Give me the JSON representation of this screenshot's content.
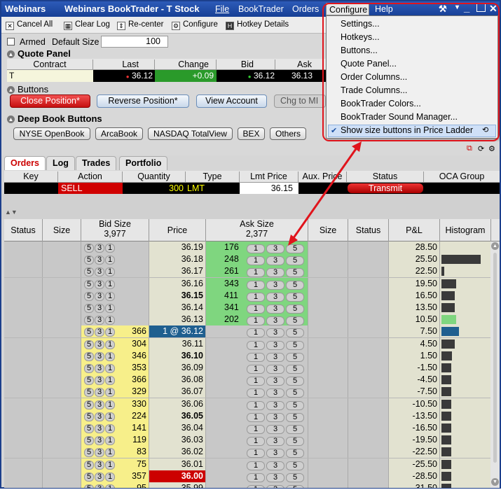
{
  "window": {
    "app_name": "Webinars",
    "title": "Webinars BookTrader - T Stock",
    "menus": [
      "File",
      "BookTrader",
      "Orders",
      "Configure",
      "Help"
    ]
  },
  "toolbar": {
    "cancel_all": "Cancel All",
    "clear_log": "Clear Log",
    "recenter": "Re-center",
    "configure": "Configure",
    "hotkey_details": "Hotkey Details"
  },
  "settings": {
    "armed_label": "Armed",
    "default_size_label": "Default Size",
    "default_size_value": "100"
  },
  "quote_panel": {
    "title": "Quote Panel",
    "headers": [
      "Contract",
      "Last",
      "Change",
      "Bid",
      "Ask"
    ],
    "contract": "T",
    "last": "36.12",
    "change": "+0.09",
    "bid": "36.12",
    "ask": "36.13"
  },
  "buttons_panel": {
    "title": "Buttons",
    "close_position": "Close Position*",
    "reverse_position": "Reverse Position*",
    "view_account": "View Account",
    "chg_to_mid": "Chg to MI"
  },
  "deep_book": {
    "title": "Deep Book Buttons",
    "buttons": [
      "NYSE OpenBook",
      "ArcaBook",
      "NASDAQ TotalView",
      "BEX",
      "Others"
    ]
  },
  "configure_menu": {
    "items": [
      "Settings...",
      "Hotkeys...",
      "Buttons...",
      "Quote Panel...",
      "Order Columns...",
      "Trade Columns...",
      "BookTrader Colors...",
      "BookTrader Sound Manager...",
      "Show size buttons in Price Ladder"
    ],
    "checked_item": "Show size buttons in Price Ladder"
  },
  "tabs": [
    "Orders",
    "Log",
    "Trades",
    "Portfolio"
  ],
  "orders": {
    "headers": [
      "Key",
      "Action",
      "Quantity",
      "Type",
      "Lmt Price",
      "Aux. Price",
      "Status",
      "OCA Group"
    ],
    "row": {
      "key": "",
      "action": "SELL",
      "quantity": "300",
      "type": "LMT",
      "lmt_price": "36.15",
      "aux_price": "",
      "status": "Transmit",
      "oca": ""
    }
  },
  "ladder": {
    "headers": {
      "status": "Status",
      "size": "Size",
      "bid_size": "Bid Size",
      "bid_total": "3,977",
      "price": "Price",
      "ask_size": "Ask Size",
      "ask_total": "2,377",
      "size2": "Size",
      "status2": "Status",
      "pl": "P&L",
      "histogram": "Histogram"
    },
    "size_buttons": [
      "5",
      "3",
      "1"
    ],
    "ask_buttons": [
      "1",
      "3",
      "5"
    ],
    "rows": [
      {
        "price": "36.19",
        "bid": "",
        "ask": "176",
        "pl": "28.50",
        "hist": 0.0
      },
      {
        "price": "36.18",
        "bid": "",
        "ask": "248",
        "pl": "25.50",
        "hist": 0.8
      },
      {
        "price": "36.17",
        "bid": "",
        "ask": "261",
        "pl": "22.50",
        "hist": 0.05
      },
      {
        "price": "36.16",
        "bid": "",
        "ask": "343",
        "pl": "19.50",
        "hist": 0.3
      },
      {
        "price": "36.15",
        "bid": "",
        "ask": "411",
        "pl": "16.50",
        "hist": 0.27
      },
      {
        "price": "36.14",
        "bid": "",
        "ask": "341",
        "pl": "13.50",
        "hist": 0.27
      },
      {
        "price": "36.13",
        "bid": "",
        "ask": "202",
        "pl": "10.50",
        "hist": 0.3
      },
      {
        "price": "1 @ 36.12",
        "bid": "366",
        "ask": "",
        "pl": "7.50",
        "hist": 0.35
      },
      {
        "price": "36.11",
        "bid": "304",
        "ask": "",
        "pl": "4.50",
        "hist": 0.27
      },
      {
        "price": "36.10",
        "bid": "346",
        "ask": "",
        "pl": "1.50",
        "hist": 0.22
      },
      {
        "price": "36.09",
        "bid": "353",
        "ask": "",
        "pl": "-1.50",
        "hist": 0.2
      },
      {
        "price": "36.08",
        "bid": "366",
        "ask": "",
        "pl": "-4.50",
        "hist": 0.2
      },
      {
        "price": "36.07",
        "bid": "329",
        "ask": "",
        "pl": "-7.50",
        "hist": 0.2
      },
      {
        "price": "36.06",
        "bid": "330",
        "ask": "",
        "pl": "-10.50",
        "hist": 0.2
      },
      {
        "price": "36.05",
        "bid": "224",
        "ask": "",
        "pl": "-13.50",
        "hist": 0.2
      },
      {
        "price": "36.04",
        "bid": "141",
        "ask": "",
        "pl": "-16.50",
        "hist": 0.2
      },
      {
        "price": "36.03",
        "bid": "119",
        "ask": "",
        "pl": "-19.50",
        "hist": 0.2
      },
      {
        "price": "36.02",
        "bid": "83",
        "ask": "",
        "pl": "-22.50",
        "hist": 0.2
      },
      {
        "price": "36.01",
        "bid": "75",
        "ask": "",
        "pl": "-25.50",
        "hist": 0.2
      },
      {
        "price": "36.00",
        "bid": "357",
        "ask": "",
        "pl": "-28.50",
        "hist": 0.2
      },
      {
        "price": "35.99",
        "bid": "95",
        "ask": "",
        "pl": "-31.50",
        "hist": 0.2
      }
    ]
  },
  "colors": {
    "accent": "#e0141c",
    "ask_green": "#7fd67f",
    "bid_yellow": "#f7ef8a",
    "title_blue": "#1c3f8c"
  }
}
